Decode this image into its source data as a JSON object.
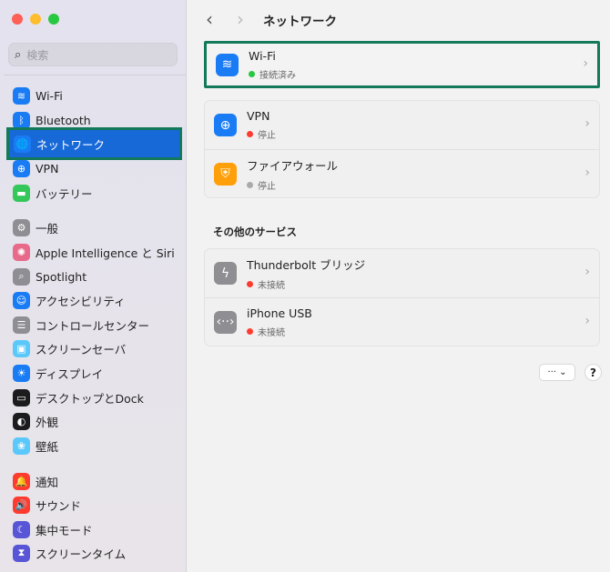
{
  "window": {
    "title": "ネットワーク"
  },
  "search": {
    "placeholder": "検索"
  },
  "sidebar": {
    "items": [
      {
        "label": "Wi-Fi",
        "icon": "wifi-icon",
        "color": "#1a7cf5",
        "glyph": "≋"
      },
      {
        "label": "Bluetooth",
        "icon": "bluetooth-icon",
        "color": "#1a7cf5",
        "glyph": "ᛒ"
      },
      {
        "label": "ネットワーク",
        "icon": "globe-icon",
        "color": "#1a7cf5",
        "glyph": "🌐",
        "selected": true
      },
      {
        "label": "VPN",
        "icon": "vpn-globe-icon",
        "color": "#1a7cf5",
        "glyph": "⊕"
      },
      {
        "label": "バッテリー",
        "icon": "battery-icon",
        "color": "#34c759",
        "glyph": "▬"
      },
      {
        "label": "一般",
        "icon": "gear-icon",
        "color": "#8e8e93",
        "glyph": "⚙"
      },
      {
        "label": "Apple Intelligence と Siri",
        "icon": "siri-icon",
        "color": "#e86a8a",
        "glyph": "✺"
      },
      {
        "label": "Spotlight",
        "icon": "spotlight-icon",
        "color": "#8e8e93",
        "glyph": "⌕"
      },
      {
        "label": "アクセシビリティ",
        "icon": "accessibility-icon",
        "color": "#1a7cf5",
        "glyph": "☺"
      },
      {
        "label": "コントロールセンター",
        "icon": "control-center-icon",
        "color": "#8e8e93",
        "glyph": "☰"
      },
      {
        "label": "スクリーンセーバ",
        "icon": "screensaver-icon",
        "color": "#5ac8fa",
        "glyph": "▣"
      },
      {
        "label": "ディスプレイ",
        "icon": "display-icon",
        "color": "#1a7cf5",
        "glyph": "☀"
      },
      {
        "label": "デスクトップとDock",
        "icon": "dock-icon",
        "color": "#1c1c1e",
        "glyph": "▭"
      },
      {
        "label": "外観",
        "icon": "appearance-icon",
        "color": "#1c1c1e",
        "glyph": "◐"
      },
      {
        "label": "壁紙",
        "icon": "wallpaper-icon",
        "color": "#5ac8fa",
        "glyph": "❀"
      },
      {
        "label": "通知",
        "icon": "bell-icon",
        "color": "#ff3b30",
        "glyph": "🔔"
      },
      {
        "label": "サウンド",
        "icon": "sound-icon",
        "color": "#ff3b30",
        "glyph": "🔊"
      },
      {
        "label": "集中モード",
        "icon": "moon-icon",
        "color": "#5856d6",
        "glyph": "☾"
      },
      {
        "label": "スクリーンタイム",
        "icon": "hourglass-icon",
        "color": "#5856d6",
        "glyph": "⧗"
      }
    ]
  },
  "main": {
    "services": [
      {
        "name": "Wi-Fi",
        "status": "接続済み",
        "status_color": "#28c840",
        "icon": "wifi-icon",
        "color": "#1a7cf5",
        "glyph": "≋"
      },
      {
        "name": "VPN",
        "status": "停止",
        "status_color": "#ff3b30",
        "icon": "vpn-globe-icon",
        "color": "#1a7cf5",
        "glyph": "⊕"
      },
      {
        "name": "ファイアウォール",
        "status": "停止",
        "status_color": "#aaaaaa",
        "icon": "firewall-shield-icon",
        "color": "#ff9f0a",
        "glyph": "⛨"
      }
    ],
    "other_title": "その他のサービス",
    "other": [
      {
        "name": "Thunderbolt ブリッジ",
        "status": "未接続",
        "status_color": "#ff3b30",
        "icon": "thunderbolt-icon",
        "color": "#8e8e93",
        "glyph": "ϟ"
      },
      {
        "name": "iPhone USB",
        "status": "未接続",
        "status_color": "#ff3b30",
        "icon": "usb-icon",
        "color": "#8e8e93",
        "glyph": "‹··›"
      }
    ],
    "more_label": "··· ⌄",
    "help_label": "?"
  }
}
